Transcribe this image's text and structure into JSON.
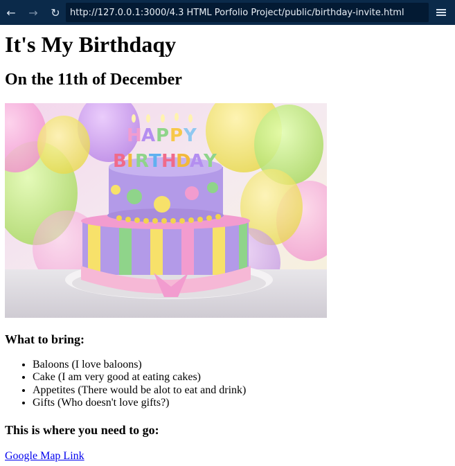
{
  "browser": {
    "url": "http://127.0.0.1:3000/4.3 HTML Porfolio Project/public/birthday-invite.html",
    "back_icon": "arrow-left-icon",
    "forward_icon": "arrow-right-icon",
    "reload_icon": "reload-icon",
    "menu_icon": "hamburger-menu-icon"
  },
  "page": {
    "title": "It's My Birthdaqy",
    "subtitle": "On the 11th of December",
    "image_caption_text": "HAPPY BIRTHDAY",
    "bring_heading": "What to bring:",
    "items": [
      "Baloons (I love baloons)",
      "Cake (I am very good at eating cakes)",
      "Appetites (There would be alot to eat and drink)",
      "Gifts (Who doesn't love gifts?)"
    ],
    "go_heading": "This is where you need to go:",
    "map_link": "Google Map Link"
  }
}
